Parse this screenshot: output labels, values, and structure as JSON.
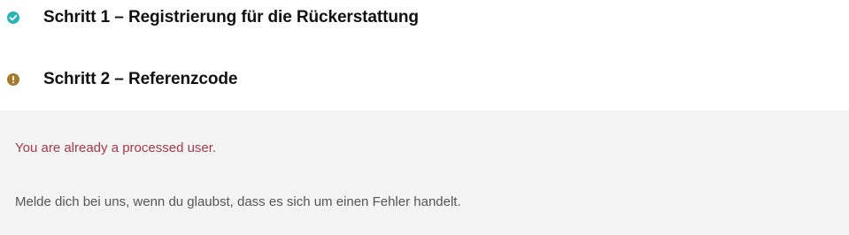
{
  "steps": [
    {
      "label": "Schritt 1 – Registrierung für die Rückerstattung",
      "status": "complete",
      "icon": "check-circle-icon",
      "color": "#2ab3b8"
    },
    {
      "label": "Schritt 2 – Referenzcode",
      "status": "warning",
      "icon": "exclamation-circle-icon",
      "color": "#a57a2e"
    }
  ],
  "panel": {
    "error_message": "You are already a processed user.",
    "note": "Melde dich bei uns, wenn du glaubst, dass es sich um einen Fehler handelt.",
    "background": "#f4f4f4",
    "error_color": "#a83a48"
  }
}
